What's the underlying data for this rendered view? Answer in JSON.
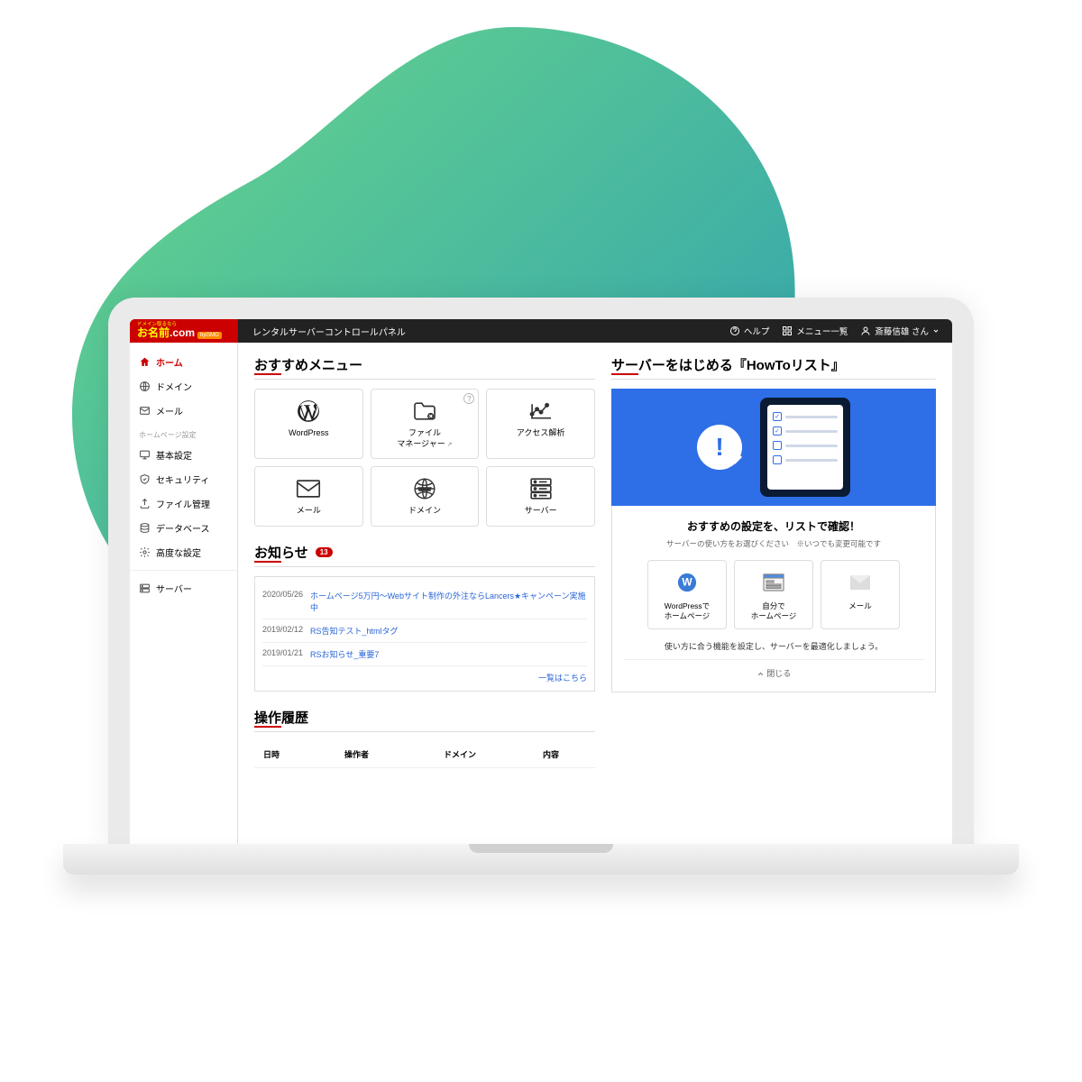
{
  "header": {
    "logo_small": "ドメイン取るなら",
    "logo_jp": "お名前",
    "logo_com": ".com",
    "logo_badge": "byGMO",
    "app_title": "レンタルサーバーコントロールパネル",
    "help": "ヘルプ",
    "menu_list": "メニュー一覧",
    "user": "斎藤信雄 さん"
  },
  "sidebar": {
    "items": [
      {
        "label": "ホーム",
        "active": true
      },
      {
        "label": "ドメイン"
      },
      {
        "label": "メール"
      }
    ],
    "group_label": "ホームページ設定",
    "hp_items": [
      {
        "label": "基本設定"
      },
      {
        "label": "セキュリティ"
      },
      {
        "label": "ファイル管理"
      },
      {
        "label": "データベース"
      },
      {
        "label": "高度な設定"
      }
    ],
    "server_label": "サーバー"
  },
  "recommend": {
    "title": "おすすめメニュー",
    "cards": [
      {
        "label": "WordPress"
      },
      {
        "label": "ファイル\nマネージャー",
        "ext": true,
        "badge": "?"
      },
      {
        "label": "アクセス解析"
      },
      {
        "label": "メール"
      },
      {
        "label": "ドメイン"
      },
      {
        "label": "サーバー"
      }
    ]
  },
  "news": {
    "title": "お知らせ",
    "count": "13",
    "items": [
      {
        "date": "2020/05/26",
        "text": "ホームページ5万円～Webサイト制作の外注ならLancers★キャンペーン実施中"
      },
      {
        "date": "2019/02/12",
        "text": "RS告知テスト_htmlタグ"
      },
      {
        "date": "2019/01/21",
        "text": "RSお知らせ_重要7"
      }
    ],
    "more": "一覧はこちら"
  },
  "howto": {
    "title": "サーバーをはじめる『HowToリスト』",
    "heading": "おすすめの設定を、リストで確認！",
    "sub": "サーバーの使い方をお選びください　※いつでも変更可能です",
    "cards": [
      {
        "label": "WordPressで\nホームページ"
      },
      {
        "label": "自分で\nホームページ"
      },
      {
        "label": "メール"
      }
    ],
    "desc": "使い方に合う機能を設定し、サーバーを最適化しましょう。",
    "close": "閉じる"
  },
  "history": {
    "title": "操作履歴",
    "cols": [
      "日時",
      "操作者",
      "ドメイン",
      "内容"
    ]
  }
}
